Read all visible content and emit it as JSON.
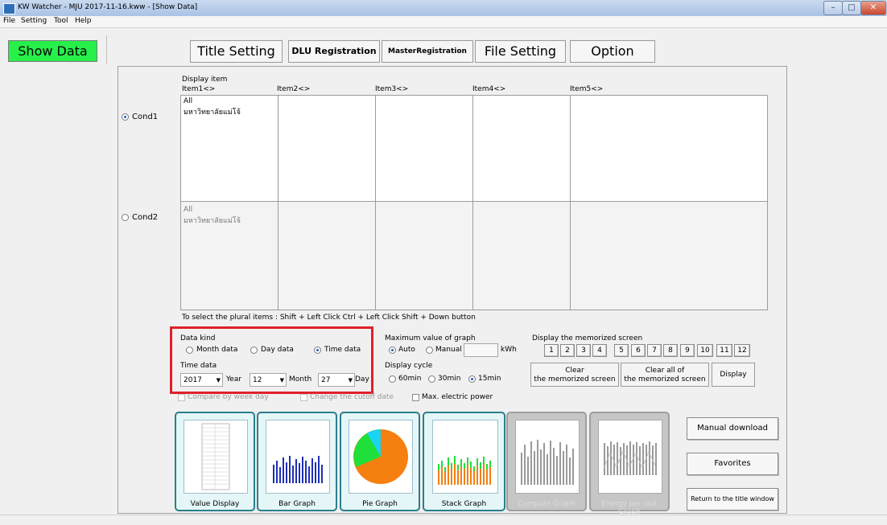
{
  "window": {
    "title": "KW Watcher - MJU 2017-11-16.kww - [Show Data]"
  },
  "menu": [
    "File",
    "Setting",
    "Tool",
    "Help"
  ],
  "left_tab": "Show Data",
  "top_tabs": {
    "title_setting": "Title Setting",
    "dlu_registration": "DLU Registration",
    "master_registration": "MasterRegistration",
    "file_setting": "File Setting",
    "option": "Option"
  },
  "display_item": {
    "label": "Display item",
    "columns": [
      "Item1<>",
      "Item2<>",
      "Item3<>",
      "Item4<>",
      "Item5<>"
    ]
  },
  "cond1": {
    "label": "Cond1",
    "selected": true,
    "items": [
      "All",
      "มหาวิทยาลัยแม่โจ้"
    ]
  },
  "cond2": {
    "label": "Cond2",
    "selected": false,
    "items": [
      "All",
      "มหาวิทยาลัยแม่โจ้"
    ]
  },
  "hint": "To select the plural items : Shift + Left Click  Ctrl + Left Click  Shift + Down button",
  "data_kind": {
    "label": "Data kind",
    "options": [
      "Month data",
      "Day data",
      "Time data"
    ],
    "selected": "Time data"
  },
  "time_data": {
    "label": "Time data",
    "year": "2017",
    "year_label": "Year",
    "month": "12",
    "month_label": "Month",
    "day": "27",
    "day_label": "Day"
  },
  "max_value": {
    "label": "Maximum value of graph",
    "options": [
      "Auto",
      "Manual"
    ],
    "selected": "Auto",
    "manual_value": "",
    "unit": "kWh"
  },
  "display_cycle": {
    "label": "Display cycle",
    "options": [
      "60min",
      "30min",
      "15min"
    ],
    "selected": "15min"
  },
  "memorized": {
    "label": "Display the memorized screen",
    "numbers": [
      "1",
      "2",
      "3",
      "4",
      "5",
      "6",
      "7",
      "8",
      "9",
      "10",
      "11",
      "12"
    ],
    "clear_line1": "Clear",
    "clear_line2": "the memorized screen",
    "clear_all_line1": "Clear all of",
    "clear_all_line2": "the memorized screen",
    "display": "Display"
  },
  "checks": {
    "compare_week": "Compare by week day",
    "cutoff": "Change the cutoff date",
    "max_power": "Max. electric power"
  },
  "graphs": [
    "Value Display",
    "Bar Graph",
    "Pie Graph",
    "Stack Graph",
    "Compare Graph",
    "Energy per unit Graph"
  ],
  "side_buttons": {
    "manual_download": "Manual download",
    "favorites": "Favorites",
    "return": "Return to the title window"
  },
  "colors": {
    "show_data_bg": "#27f04b",
    "highlight": "#e0202a",
    "bar_blue": "#1f2fb5",
    "pie_orange": "#f57f0f",
    "pie_green": "#1fe03a",
    "pie_cyan": "#19d3f0"
  }
}
